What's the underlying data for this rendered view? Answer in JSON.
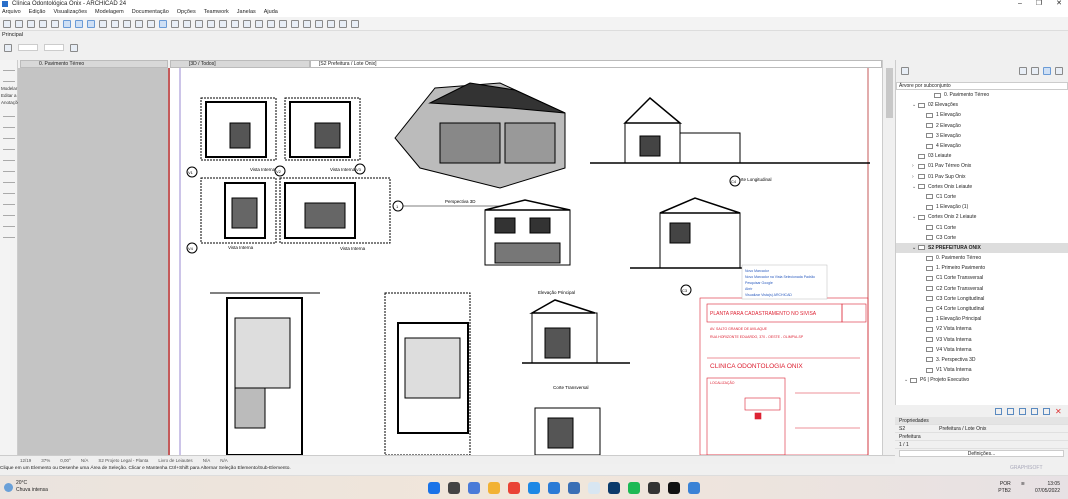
{
  "window": {
    "title": "Clínica Odontológica Onix - ARCHICAD 24",
    "controls": [
      "–",
      "❐",
      "✕"
    ]
  },
  "menu": [
    "Arquivo",
    "Edição",
    "Visualizações",
    "Modelagem",
    "Documentação",
    "Opções",
    "Teamwork",
    "Janelas",
    "Ajuda"
  ],
  "info_box": {
    "label": "Principal"
  },
  "toolbox": {
    "labels": [
      "Modelar",
      "Editar a",
      "Anotações"
    ]
  },
  "tabs": [
    {
      "label": "0. Pavimento Térreo"
    },
    {
      "label": "[3D / Todos]"
    },
    {
      "label": "[S2 Prefeitura / Lote Onix]"
    }
  ],
  "canvas": {
    "labels": {
      "vista_interna": "Vista Interna",
      "perspectiva": "Perspectiva 3D",
      "corte_longitudinal": "Corte Longitudinal",
      "elevacao_principal": "Elevação Principal",
      "corte_transversal": "Corte Transversal",
      "markers": [
        "V1",
        "V2",
        "V3",
        "V4",
        "C4",
        "C3",
        "1"
      ]
    },
    "context_menu": [
      "Novo Marcador",
      "Novo Marcador na Vista Selecionada Padrão",
      "Pesquisar Google",
      "Abrir",
      "Visualizar Vista(s) ARCHICAD"
    ],
    "title_block": {
      "heading": "PLANTA PARA CADASTRAMENTO NO SIVISA",
      "owner": "CLINICA ODONTOLOGIA ONIX",
      "address": "AV. SALTO GRANDE DE AVILAQUE",
      "location": "LOCALIZAÇÃO",
      "line1": "RUA HORIZONTE EDUARDO, 370 - OESTE - OLIMPIA-SP"
    }
  },
  "navigator": {
    "view_select": "Árvore por subconjunto",
    "items": [
      {
        "label": "0. Pavimento Térreo",
        "level": 3,
        "arrow": ""
      },
      {
        "label": "02 Elevações",
        "level": 1,
        "arrow": "⌄"
      },
      {
        "label": "1 Elevação",
        "level": 2,
        "arrow": ""
      },
      {
        "label": "2 Elevação",
        "level": 2,
        "arrow": ""
      },
      {
        "label": "3 Elevação",
        "level": 2,
        "arrow": ""
      },
      {
        "label": "4 Elevação",
        "level": 2,
        "arrow": ""
      },
      {
        "label": "03 Leiaute",
        "level": 1,
        "arrow": ""
      },
      {
        "label": "01 Pav Térreo Onix",
        "level": 1,
        "arrow": "›"
      },
      {
        "label": "01 Pav Sup Onix",
        "level": 1,
        "arrow": "›"
      },
      {
        "label": "Cortes Onix Leiaute",
        "level": 1,
        "arrow": "⌄"
      },
      {
        "label": "C1 Corte",
        "level": 2,
        "arrow": ""
      },
      {
        "label": "1 Elevação (1)",
        "level": 2,
        "arrow": ""
      },
      {
        "label": "Cortes Onix 2 Leiaute",
        "level": 1,
        "arrow": "⌄"
      },
      {
        "label": "C1 Corte",
        "level": 2,
        "arrow": ""
      },
      {
        "label": "C3 Corte",
        "level": 2,
        "arrow": ""
      },
      {
        "label": "S2 PREFEITURA ONIX",
        "level": 1,
        "arrow": "⌄",
        "highlight": true
      },
      {
        "label": "0. Pavimento Térreo",
        "level": 2,
        "arrow": ""
      },
      {
        "label": "1. Primeiro Pavimento",
        "level": 2,
        "arrow": ""
      },
      {
        "label": "C1 Corte Transversal",
        "level": 2,
        "arrow": ""
      },
      {
        "label": "C2 Corte Transversal",
        "level": 2,
        "arrow": ""
      },
      {
        "label": "C3 Corte Longitudinal",
        "level": 2,
        "arrow": ""
      },
      {
        "label": "C4 Corte Longitudinal",
        "level": 2,
        "arrow": ""
      },
      {
        "label": "1 Elevação Principal",
        "level": 2,
        "arrow": ""
      },
      {
        "label": "V2 Vista Interna",
        "level": 2,
        "arrow": ""
      },
      {
        "label": "V3 Vista Interna",
        "level": 2,
        "arrow": ""
      },
      {
        "label": "V4 Vista Interna",
        "level": 2,
        "arrow": ""
      },
      {
        "label": "3. Perspectiva 3D",
        "level": 2,
        "arrow": ""
      },
      {
        "label": "V1 Vista Interna",
        "level": 2,
        "arrow": ""
      },
      {
        "label": "P6 | Projeto Executivo",
        "level": 0,
        "arrow": "⌄"
      }
    ]
  },
  "properties": {
    "header": "Propriedades",
    "id": "S2",
    "name": "Prefeitura / Lote Onix",
    "master": "Prefeitura",
    "pages": "1 / 1",
    "settings_button": "Definições..."
  },
  "statusbar": {
    "page": "12/19",
    "zoom": "37%",
    "angle": "0,00°",
    "scale": "N/A",
    "layer_combo": "S2 Projeto Legal - Planta",
    "layout_book": "Livro de Leiautes",
    "pen": "N/A",
    "model": "N/A",
    "message": "Clique em um Elemento ou Desenhe uma Área de Seleção. Clicar e Mantenha Ctrl+Shift para Alternar Seleção Elemento/Sub-Elemento."
  },
  "brand": "GRAPHISOFT",
  "taskbar": {
    "weather_temp": "20°C",
    "weather_desc": "Chuva intensa",
    "lang": "POR",
    "lang2": "PTB2",
    "time": "13:05",
    "date": "07/05/2022",
    "app_colors": [
      "#1a73e8",
      "#444",
      "#4a7bd8",
      "#f2b233",
      "#ea4335",
      "#1e88e5",
      "#2b7bd6",
      "#3a6fb5",
      "#d8e6f2",
      "#0b3a6b",
      "#1db954",
      "#333",
      "#111",
      "#3a82d6"
    ]
  }
}
